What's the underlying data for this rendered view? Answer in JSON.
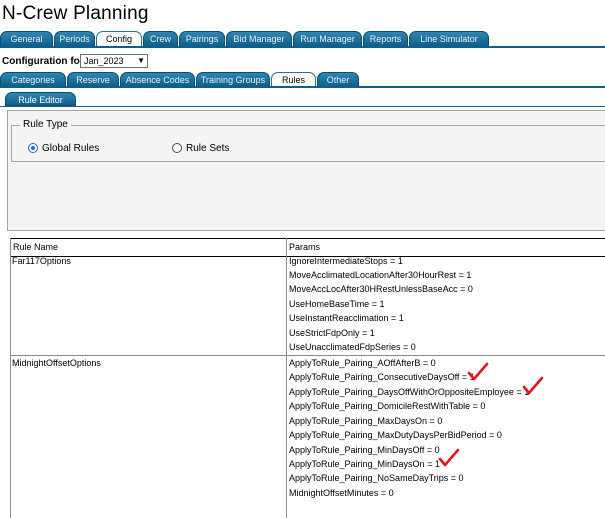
{
  "app": {
    "title": "N-Crew Planning"
  },
  "main_tabs": [
    "General",
    "Periods",
    "Config",
    "Crew",
    "Pairings",
    "Bid Manager",
    "Run Manager",
    "Reports",
    "Line Simulator"
  ],
  "config": {
    "label": "Configuration for",
    "selected": "Jan_2023"
  },
  "sub_tabs": [
    "Categories",
    "Reserve",
    "Absence Codes",
    "Training Groups",
    "Rules",
    "Other"
  ],
  "rule_editor_tab": "Rule Editor",
  "rule_type": {
    "legend": "Rule Type",
    "options": [
      "Global Rules",
      "Rule Sets"
    ],
    "selected": "Global Rules"
  },
  "table": {
    "headers": [
      "Rule Name",
      "Params"
    ],
    "groups": [
      {
        "name": "Far117Options",
        "params": [
          "IgnoreIntermediateStops = 1",
          "MoveAcclimatedLocationAfter30HourRest = 1",
          "MoveAccLocAfter30HRestUnlessBaseAcc = 0",
          "UseHomeBaseTime = 1",
          "UseInstantReacclimation = 1",
          "UseStrictFdpOnly = 1",
          "UseUnacclimatedFdpSeries = 0"
        ]
      },
      {
        "name": "MidnightOffsetOptions",
        "params": [
          "ApplyToRule_Pairing_AOffAfterB = 0",
          "ApplyToRule_Pairing_ConsecutiveDaysOff = 1",
          "ApplyToRule_Pairing_DaysOffWithOrOppositeEmployee = 1",
          "ApplyToRule_Pairing_DomicileRestWithTable = 0",
          "ApplyToRule_Pairing_MaxDaysOn = 0",
          "ApplyToRule_Pairing_MaxDutyDaysPerBidPeriod = 0",
          "ApplyToRule_Pairing_MinDaysOff = 0",
          "ApplyToRule_Pairing_MinDaysOn = 1",
          "ApplyToRule_Pairing_NoSameDayTrips = 0",
          "MidnightOffsetMinutes = 0"
        ]
      }
    ]
  },
  "annotations": {
    "checkmark_color": "#e0141e",
    "tab_color": "#0f5f8a"
  }
}
